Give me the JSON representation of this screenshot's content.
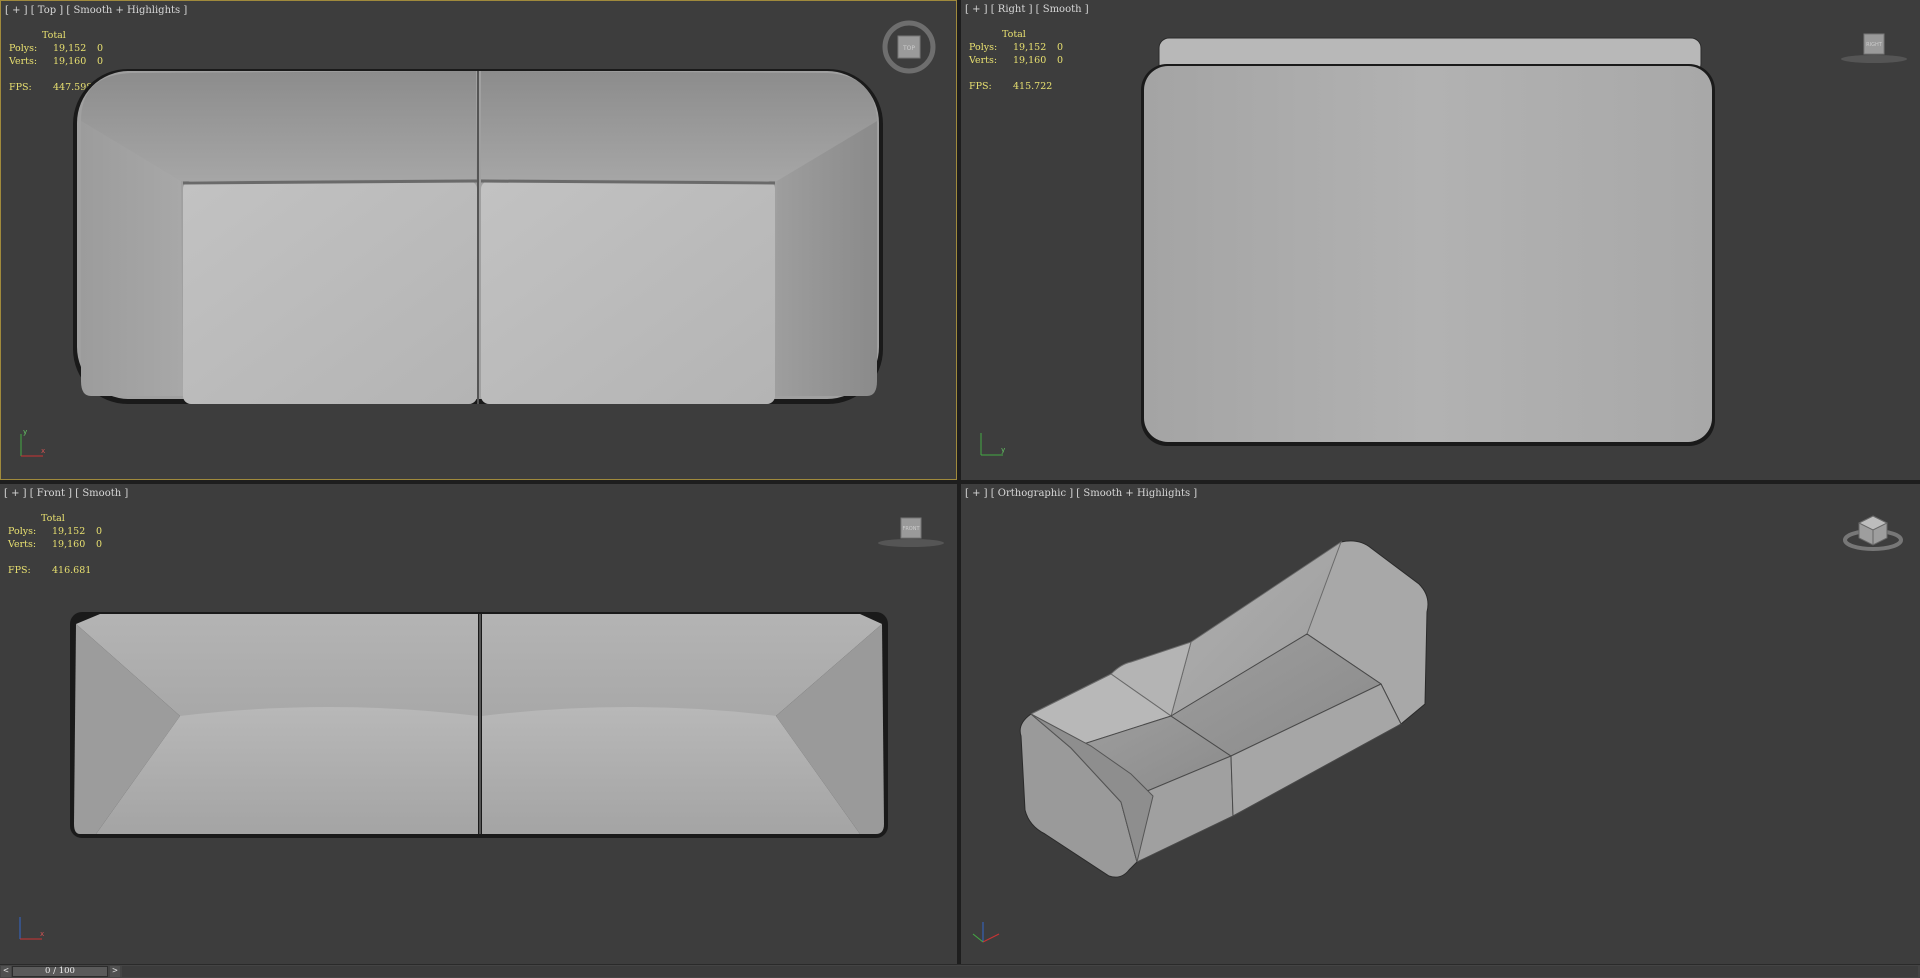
{
  "viewports": {
    "top": {
      "label": "[ + ] [ Top ] [ Smooth + Highlights ]",
      "fps": "447.598"
    },
    "right": {
      "label": "[ + ] [ Right ] [ Smooth ]",
      "fps": "415.722"
    },
    "front": {
      "label": "[ + ] [ Front ] [ Smooth ]",
      "fps": "416.681"
    },
    "persp": {
      "label": "[ + ] [ Orthographic ] [ Smooth + Highlights ]"
    }
  },
  "stats": {
    "total_label": "Total",
    "polys_label": "Polys:",
    "verts_label": "Verts:",
    "fps_label": "FPS:",
    "polys_value": "19,152",
    "verts_value": "19,160",
    "polys_sel": "0",
    "verts_sel": "0"
  },
  "navcube": {
    "top_face": "TOP",
    "right_face": "RIGHT",
    "front_face": "FRONT"
  },
  "timeline": {
    "frame": "0 / 100",
    "prev": "<",
    "next": ">"
  },
  "colors": {
    "active_border": "#a08a3c",
    "stats_text": "#e8e070",
    "viewport_bg": "#3d3d3d"
  }
}
